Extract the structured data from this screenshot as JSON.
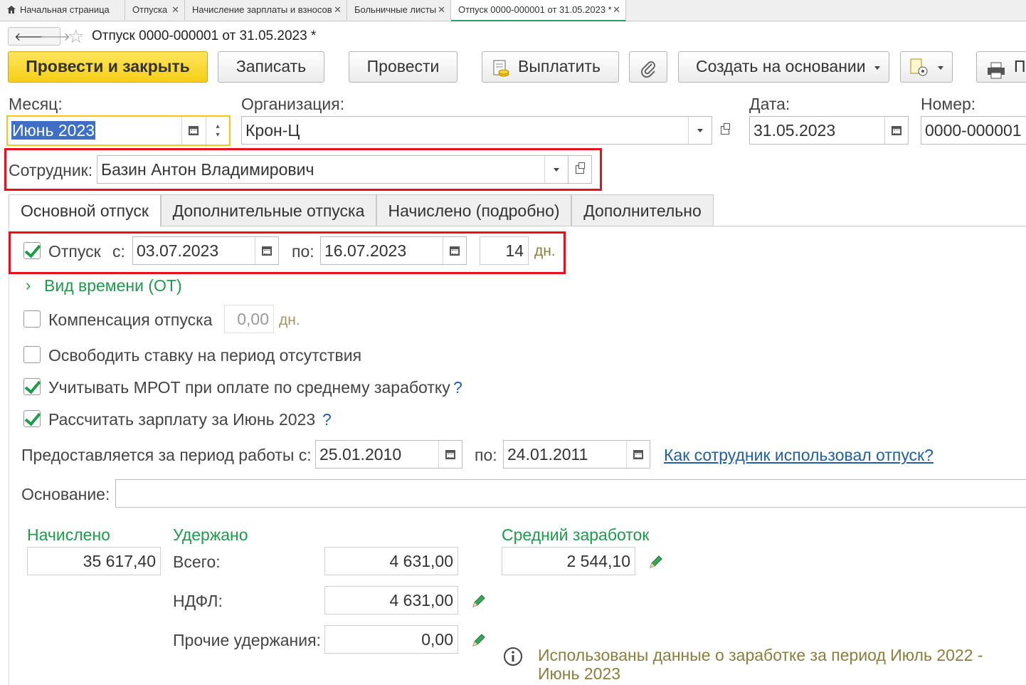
{
  "window_tabs": [
    {
      "label": "Начальная страница"
    },
    {
      "label": "Отпуска"
    },
    {
      "label": "Начисление зарплаты и взносов"
    },
    {
      "label": "Больничные листы"
    },
    {
      "label": "Отпуск 0000-000001 от 31.05.2023 *"
    }
  ],
  "header": {
    "title": "Отпуск 0000-000001 от 31.05.2023 *"
  },
  "toolbar": {
    "post_close": "Провести и закрыть",
    "save": "Записать",
    "post": "Провести",
    "pay": "Выплатить",
    "create_based": "Создать на основании",
    "print": "П"
  },
  "form": {
    "month_label": "Месяц:",
    "month_value": "Июнь 2023",
    "org_label": "Организация:",
    "org_value": "Крон-Ц",
    "date_label": "Дата:",
    "date_value": "31.05.2023",
    "number_label": "Номер:",
    "number_value": "0000-000001",
    "employee_label": "Сотрудник:",
    "employee_value": "Базин Антон Владимирович"
  },
  "form_tabs": [
    {
      "label": "Основной отпуск"
    },
    {
      "label": "Дополнительные отпуска"
    },
    {
      "label": "Начислено (подробно)"
    },
    {
      "label": "Дополнительно"
    }
  ],
  "vacation": {
    "label": "Отпуск",
    "from_label": "с:",
    "from_value": "03.07.2023",
    "to_label": "по:",
    "to_value": "16.07.2023",
    "days_value": "14",
    "days_unit": "дн.",
    "time_type_link": "Вид времени (ОТ)"
  },
  "options": {
    "compensation_label": "Компенсация отпуска",
    "compensation_value": "0,00",
    "compensation_unit": "дн.",
    "free_rate_label": "Освободить ставку на период отсутствия",
    "mrot_label": "Учитывать МРОТ при оплате по среднему заработку",
    "calc_salary_label": "Рассчитать зарплату за Июнь 2023",
    "help": "?"
  },
  "period": {
    "label": "Предоставляется за период работы с:",
    "from_value": "25.01.2010",
    "to_label": "по:",
    "to_value": "24.01.2011",
    "link": "Как сотрудник использовал отпуск?"
  },
  "basis": {
    "label": "Основание:",
    "value": ""
  },
  "totals": {
    "accrued_header": "Начислено",
    "accrued_value": "35 617,40",
    "withheld_header": "Удержано",
    "total_label": "Всего:",
    "total_value": "4 631,00",
    "ndfl_label": "НДФЛ:",
    "ndfl_value": "4 631,00",
    "other_label": "Прочие удержания:",
    "other_value": "0,00",
    "avg_header": "Средний заработок",
    "avg_value": "2 544,10",
    "info_text": "Использованы данные о заработке за период Июль 2022 - Июнь 2023"
  },
  "colors": {
    "accent_green": "#1e9b4a",
    "highlight_red": "#e8101a",
    "primary_yellow": "#f5cf17",
    "link_blue": "#1f5ea8"
  }
}
